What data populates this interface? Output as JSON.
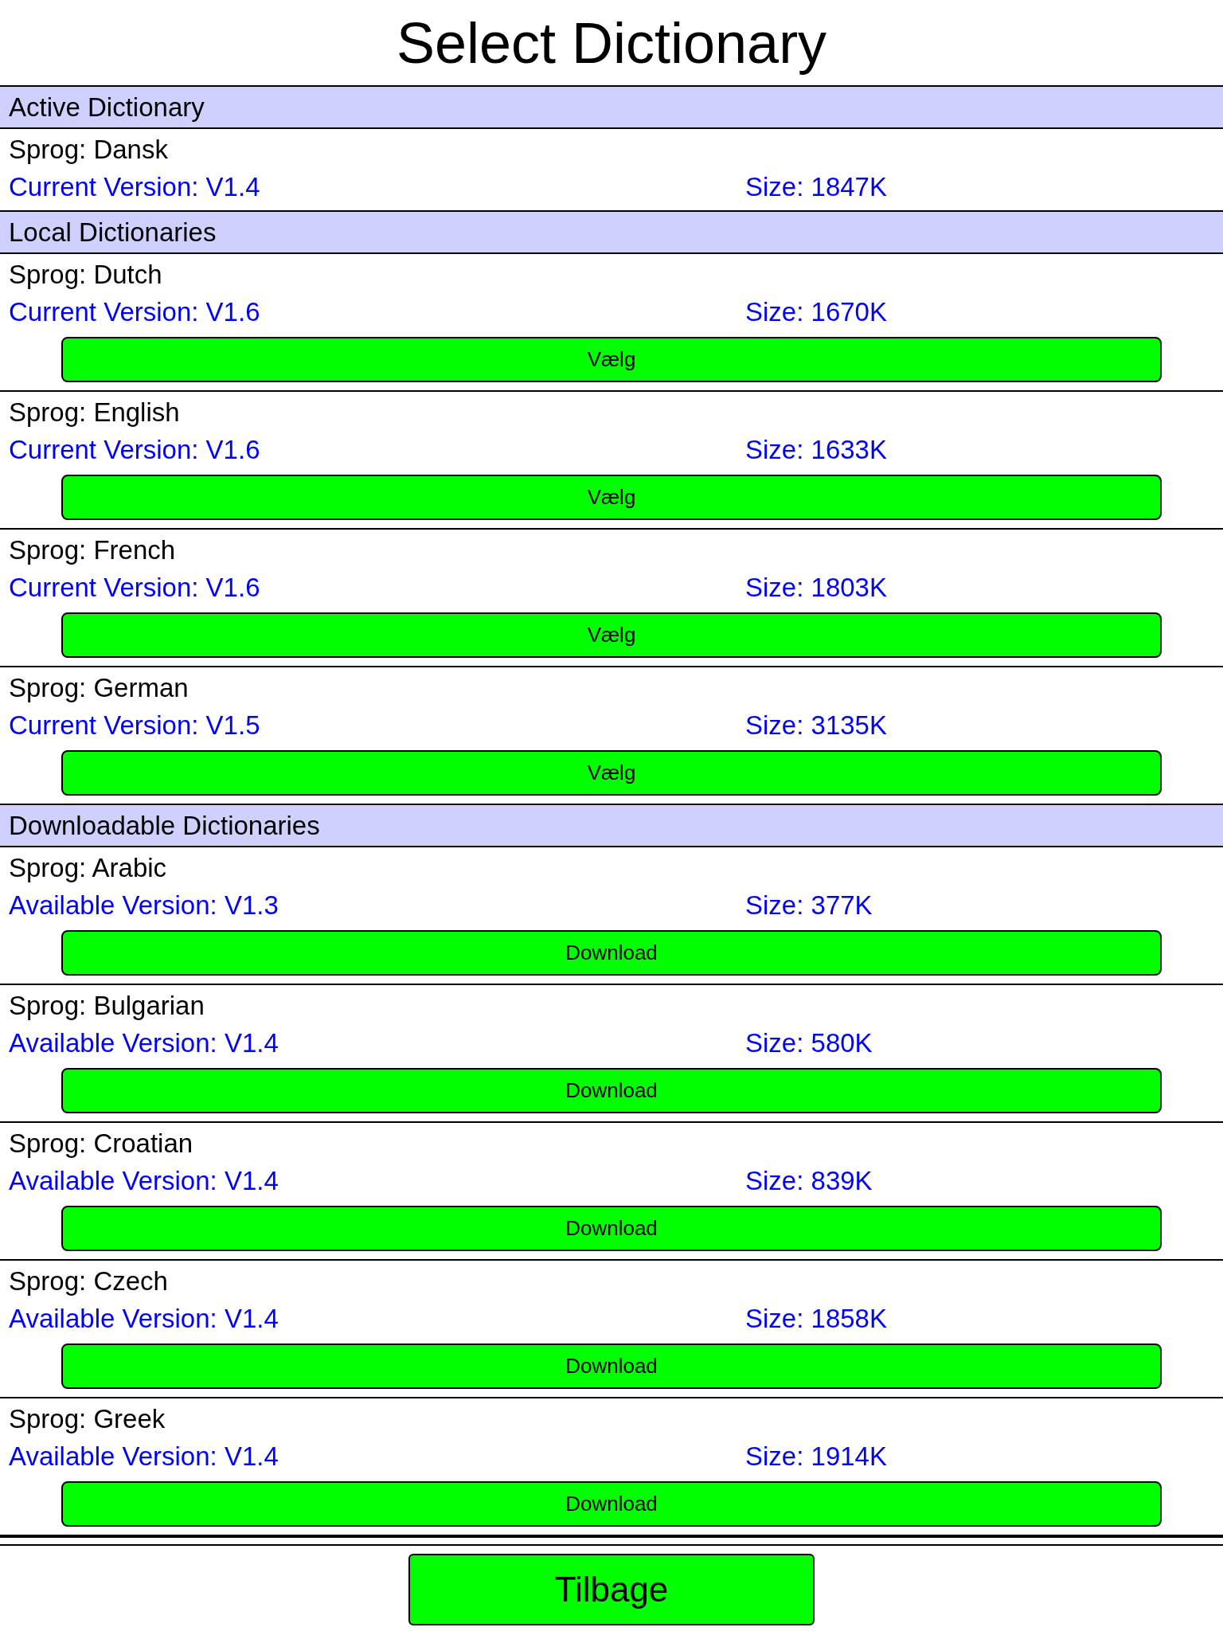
{
  "title": "Select Dictionary",
  "sections": [
    {
      "header": "Active Dictionary",
      "items": [
        {
          "language": "Sprog: Dansk",
          "version": "Current Version: V1.4",
          "size": "Size: 1847K"
        }
      ]
    },
    {
      "header": "Local Dictionaries",
      "items": [
        {
          "language": "Sprog: Dutch",
          "version": "Current Version: V1.6",
          "size": "Size: 1670K",
          "button": "Vælg"
        },
        {
          "language": "Sprog: English",
          "version": "Current Version: V1.6",
          "size": "Size: 1633K",
          "button": "Vælg"
        },
        {
          "language": "Sprog: French",
          "version": "Current Version: V1.6",
          "size": "Size: 1803K",
          "button": "Vælg"
        },
        {
          "language": "Sprog: German",
          "version": "Current Version: V1.5",
          "size": "Size: 3135K",
          "button": "Vælg"
        }
      ]
    },
    {
      "header": "Downloadable Dictionaries",
      "items": [
        {
          "language": "Sprog: Arabic",
          "version": "Available Version: V1.3",
          "size": "Size: 377K",
          "button": "Download"
        },
        {
          "language": "Sprog: Bulgarian",
          "version": "Available Version: V1.4",
          "size": "Size: 580K",
          "button": "Download"
        },
        {
          "language": "Sprog: Croatian",
          "version": "Available Version: V1.4",
          "size": "Size: 839K",
          "button": "Download"
        },
        {
          "language": "Sprog: Czech",
          "version": "Available Version: V1.4",
          "size": "Size: 1858K",
          "button": "Download"
        },
        {
          "language": "Sprog: Greek",
          "version": "Available Version: V1.4",
          "size": "Size: 1914K",
          "button": "Download"
        }
      ]
    }
  ],
  "back_button": "Tilbage"
}
